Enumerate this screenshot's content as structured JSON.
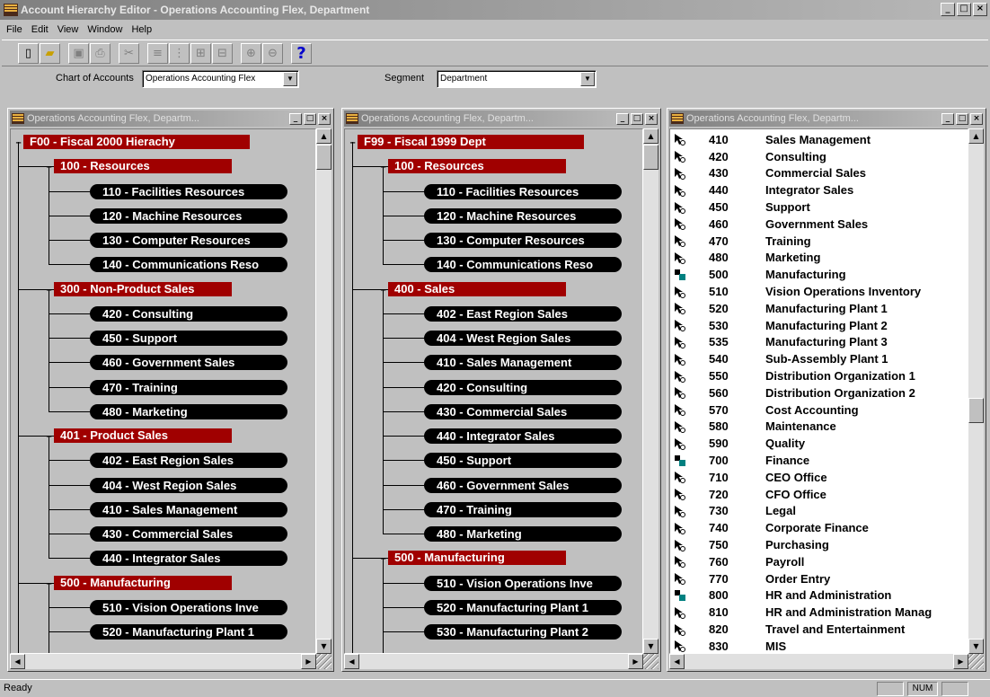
{
  "app": {
    "title": "Account Hierarchy Editor - Operations Accounting Flex, Department"
  },
  "menu": [
    "File",
    "Edit",
    "View",
    "Window",
    "Help"
  ],
  "toolbar": {
    "icons": [
      "new-icon",
      "open-icon",
      "save-icon",
      "print-icon",
      "cut-icon",
      "tree1-icon",
      "tree2-icon",
      "tree3-icon",
      "tree4-icon",
      "zoom-in-icon",
      "zoom-out-icon",
      "help-icon"
    ],
    "help_label": "?"
  },
  "selectors": {
    "chart_label": "Chart of Accounts",
    "chart_value": "Operations Accounting Flex",
    "segment_label": "Segment",
    "segment_value": "Department"
  },
  "panes": [
    {
      "title": "Operations Accounting Flex, Departm...",
      "nodes": [
        {
          "label": "F00 - Fiscal 2000 Hierachy",
          "type": "root"
        },
        {
          "label": "100 - Resources",
          "type": "group"
        },
        {
          "label": "110 - Facilities Resources",
          "type": "leaf"
        },
        {
          "label": "120 - Machine Resources",
          "type": "leaf"
        },
        {
          "label": "130 - Computer Resources",
          "type": "leaf"
        },
        {
          "label": "140 - Communications Reso",
          "type": "leaf"
        },
        {
          "label": "300 - Non-Product Sales",
          "type": "group"
        },
        {
          "label": "420 - Consulting",
          "type": "leaf"
        },
        {
          "label": "450 - Support",
          "type": "leaf"
        },
        {
          "label": "460 - Government Sales",
          "type": "leaf"
        },
        {
          "label": "470 - Training",
          "type": "leaf"
        },
        {
          "label": "480 - Marketing",
          "type": "leaf"
        },
        {
          "label": "401 - Product Sales",
          "type": "group"
        },
        {
          "label": "402 - East Region Sales",
          "type": "leaf"
        },
        {
          "label": "404 - West Region Sales",
          "type": "leaf"
        },
        {
          "label": "410 - Sales Management",
          "type": "leaf"
        },
        {
          "label": "430 - Commercial Sales",
          "type": "leaf"
        },
        {
          "label": "440 - Integrator Sales",
          "type": "leaf"
        },
        {
          "label": "500 - Manufacturing",
          "type": "group"
        },
        {
          "label": "510 - Vision Operations Inve",
          "type": "leaf"
        },
        {
          "label": "520 - Manufacturing Plant 1",
          "type": "leaf"
        }
      ]
    },
    {
      "title": "Operations Accounting Flex, Departm...",
      "nodes": [
        {
          "label": "F99 - Fiscal 1999 Dept",
          "type": "root"
        },
        {
          "label": "100 - Resources",
          "type": "group"
        },
        {
          "label": "110 - Facilities Resources",
          "type": "leaf"
        },
        {
          "label": "120 - Machine Resources",
          "type": "leaf"
        },
        {
          "label": "130 - Computer Resources",
          "type": "leaf"
        },
        {
          "label": "140 - Communications Reso",
          "type": "leaf"
        },
        {
          "label": "400 - Sales",
          "type": "group"
        },
        {
          "label": "402 - East Region Sales",
          "type": "leaf"
        },
        {
          "label": "404 - West Region Sales",
          "type": "leaf"
        },
        {
          "label": "410 - Sales Management",
          "type": "leaf"
        },
        {
          "label": "420 - Consulting",
          "type": "leaf"
        },
        {
          "label": "430 - Commercial Sales",
          "type": "leaf"
        },
        {
          "label": "440 - Integrator Sales",
          "type": "leaf"
        },
        {
          "label": "450 - Support",
          "type": "leaf"
        },
        {
          "label": "460 - Government Sales",
          "type": "leaf"
        },
        {
          "label": "470 - Training",
          "type": "leaf"
        },
        {
          "label": "480 - Marketing",
          "type": "leaf"
        },
        {
          "label": "500 - Manufacturing",
          "type": "group"
        },
        {
          "label": "510 - Vision Operations Inve",
          "type": "leaf"
        },
        {
          "label": "520 - Manufacturing Plant 1",
          "type": "leaf"
        },
        {
          "label": "530 - Manufacturing Plant 2",
          "type": "leaf"
        }
      ]
    },
    {
      "title": "Operations Accounting Flex, Departm...",
      "items": [
        {
          "code": "410",
          "name": "Sales Management",
          "icon": "pointer"
        },
        {
          "code": "420",
          "name": "Consulting",
          "icon": "pointer"
        },
        {
          "code": "430",
          "name": "Commercial Sales",
          "icon": "pointer"
        },
        {
          "code": "440",
          "name": "Integrator Sales",
          "icon": "pointer"
        },
        {
          "code": "450",
          "name": "Support",
          "icon": "pointer"
        },
        {
          "code": "460",
          "name": "Government Sales",
          "icon": "pointer"
        },
        {
          "code": "470",
          "name": "Training",
          "icon": "pointer"
        },
        {
          "code": "480",
          "name": "Marketing",
          "icon": "pointer"
        },
        {
          "code": "500",
          "name": "Manufacturing",
          "icon": "parent"
        },
        {
          "code": "510",
          "name": "Vision Operations Inventory",
          "icon": "pointer"
        },
        {
          "code": "520",
          "name": "Manufacturing Plant 1",
          "icon": "pointer"
        },
        {
          "code": "530",
          "name": "Manufacturing Plant 2",
          "icon": "pointer"
        },
        {
          "code": "535",
          "name": "Manufacturing Plant 3",
          "icon": "pointer"
        },
        {
          "code": "540",
          "name": "Sub-Assembly Plant 1",
          "icon": "pointer"
        },
        {
          "code": "550",
          "name": "Distribution Organization 1",
          "icon": "pointer"
        },
        {
          "code": "560",
          "name": "Distribution Organization 2",
          "icon": "pointer"
        },
        {
          "code": "570",
          "name": "Cost Accounting",
          "icon": "pointer"
        },
        {
          "code": "580",
          "name": "Maintenance",
          "icon": "pointer"
        },
        {
          "code": "590",
          "name": "Quality",
          "icon": "pointer"
        },
        {
          "code": "700",
          "name": "Finance",
          "icon": "parent"
        },
        {
          "code": "710",
          "name": "CEO Office",
          "icon": "pointer"
        },
        {
          "code": "720",
          "name": "CFO Office",
          "icon": "pointer"
        },
        {
          "code": "730",
          "name": "Legal",
          "icon": "pointer"
        },
        {
          "code": "740",
          "name": "Corporate Finance",
          "icon": "pointer"
        },
        {
          "code": "750",
          "name": "Purchasing",
          "icon": "pointer"
        },
        {
          "code": "760",
          "name": "Payroll",
          "icon": "pointer"
        },
        {
          "code": "770",
          "name": "Order Entry",
          "icon": "pointer"
        },
        {
          "code": "800",
          "name": "HR and Administration",
          "icon": "parent"
        },
        {
          "code": "810",
          "name": "HR and Administration Manag",
          "icon": "pointer"
        },
        {
          "code": "820",
          "name": "Travel and Entertainment",
          "icon": "pointer"
        },
        {
          "code": "830",
          "name": "MIS",
          "icon": "pointer"
        }
      ]
    }
  ],
  "status": {
    "text": "Ready",
    "num": "NUM"
  },
  "colors": {
    "node_red": "#a00000",
    "node_black": "#000000",
    "desktop": "#c0c0c0"
  }
}
